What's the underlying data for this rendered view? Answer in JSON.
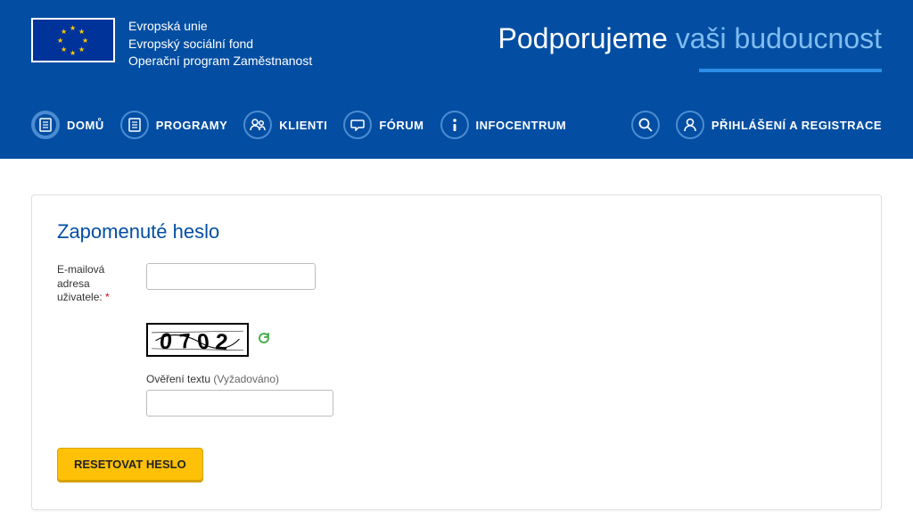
{
  "header": {
    "org_line1": "Evropská unie",
    "org_line2": "Evropský sociální fond",
    "org_line3": "Operační program Zaměstnanost",
    "tagline_main": "Podporujeme",
    "tagline_accent": "vaši budoucnost"
  },
  "nav": {
    "home": "DOMŮ",
    "programs": "PROGRAMY",
    "clients": "KLIENTI",
    "forum": "FÓRUM",
    "infocenter": "INFOCENTRUM",
    "login": "PŘIHLÁŠENÍ A REGISTRACE"
  },
  "form": {
    "title": "Zapomenuté heslo",
    "email_label": "E-mailová adresa uživatele:",
    "email_required_mark": "*",
    "email_value": "",
    "captcha_text": "0702",
    "verify_label": "Ověření textu",
    "verify_hint": "(Vyžadováno)",
    "verify_value": "",
    "submit": "RESETOVAT HESLO"
  },
  "colors": {
    "brand_blue": "#034ea2",
    "light_blue": "#7fbcf0",
    "accent_yellow": "#ffc107"
  }
}
